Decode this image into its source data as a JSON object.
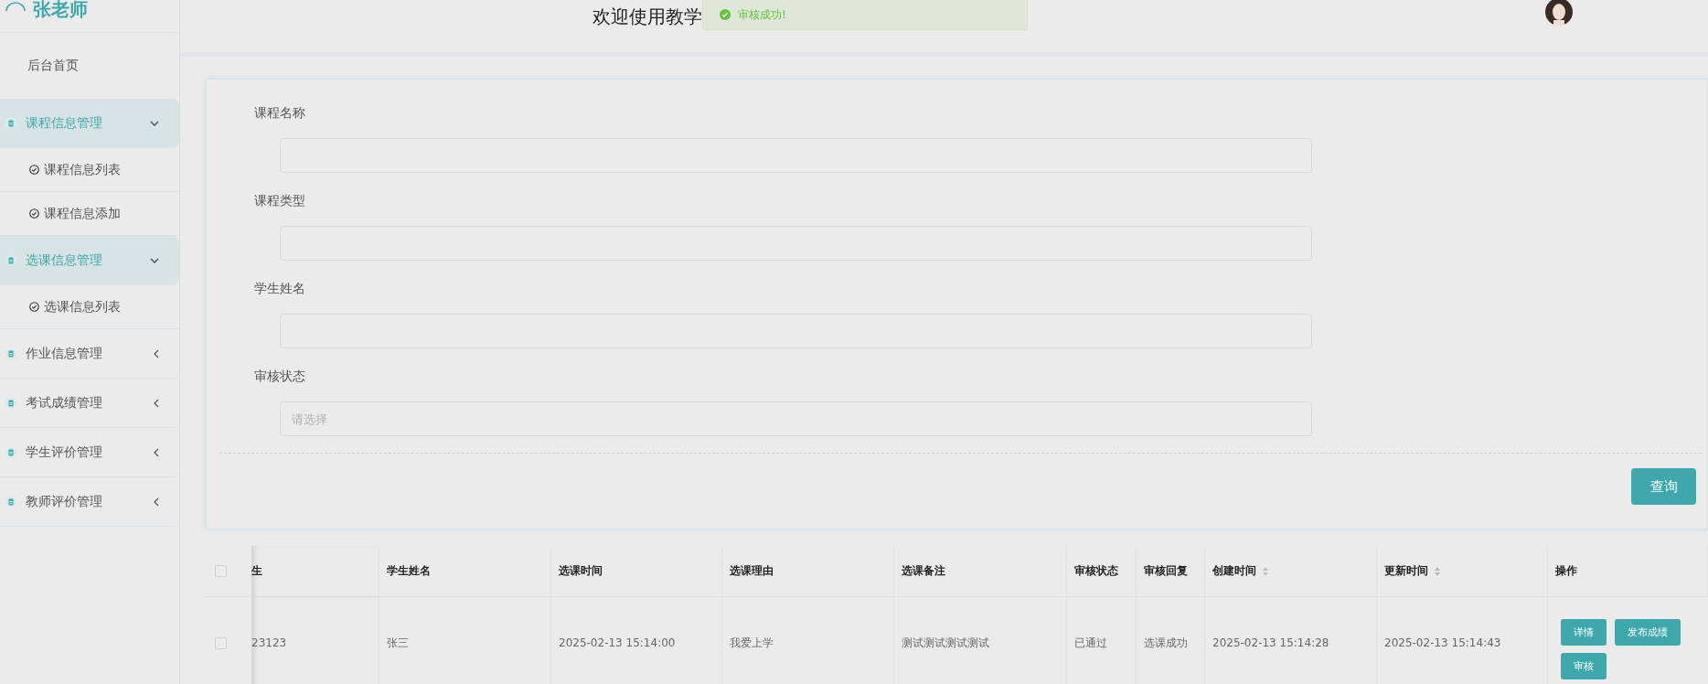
{
  "sidebar": {
    "user": "张老师",
    "items": [
      {
        "label": "后台首页",
        "kind": "link"
      },
      {
        "label": "课程信息管理",
        "kind": "group",
        "expanded": true,
        "children": [
          {
            "label": "课程信息列表"
          },
          {
            "label": "课程信息添加"
          }
        ]
      },
      {
        "label": "选课信息管理",
        "kind": "group",
        "expanded": true,
        "children": [
          {
            "label": "选课信息列表"
          }
        ]
      },
      {
        "label": "作业信息管理",
        "kind": "group",
        "expanded": false
      },
      {
        "label": "考试成绩管理",
        "kind": "group",
        "expanded": false
      },
      {
        "label": "学生评价管理",
        "kind": "group",
        "expanded": false
      },
      {
        "label": "教师评价管理",
        "kind": "group",
        "expanded": false
      }
    ]
  },
  "header": {
    "title": "欢迎使用教学"
  },
  "toast": {
    "message": "审核成功!"
  },
  "search_form": {
    "fields": [
      {
        "label": "课程名称",
        "kind": "input"
      },
      {
        "label": "课程类型",
        "kind": "input"
      },
      {
        "label": "学生姓名",
        "kind": "input"
      },
      {
        "label": "审核状态",
        "kind": "select",
        "placeholder": "请选择"
      }
    ],
    "submit": "查询"
  },
  "table": {
    "all_selected": false,
    "columns": [
      {
        "label": "生",
        "sortable": false
      },
      {
        "label": "学生姓名",
        "sortable": false
      },
      {
        "label": "选课时间",
        "sortable": false
      },
      {
        "label": "选课理由",
        "sortable": false
      },
      {
        "label": "选课备注",
        "sortable": false
      },
      {
        "label": "审核状态",
        "sortable": false
      },
      {
        "label": "审核回复",
        "sortable": false
      },
      {
        "label": "创建时间",
        "sortable": true
      },
      {
        "label": "更新时间",
        "sortable": true
      },
      {
        "label": "操作",
        "sortable": false
      }
    ],
    "rows": [
      {
        "selected": false,
        "cells": [
          "23123",
          "张三",
          "2025-02-13 15:14:00",
          "我爱上学",
          "测试测试测试测试",
          "已通过",
          "选课成功",
          "2025-02-13 15:14:28",
          "2025-02-13 15:14:43"
        ],
        "actions": [
          "详情",
          "发布成绩",
          "审核"
        ]
      }
    ]
  }
}
